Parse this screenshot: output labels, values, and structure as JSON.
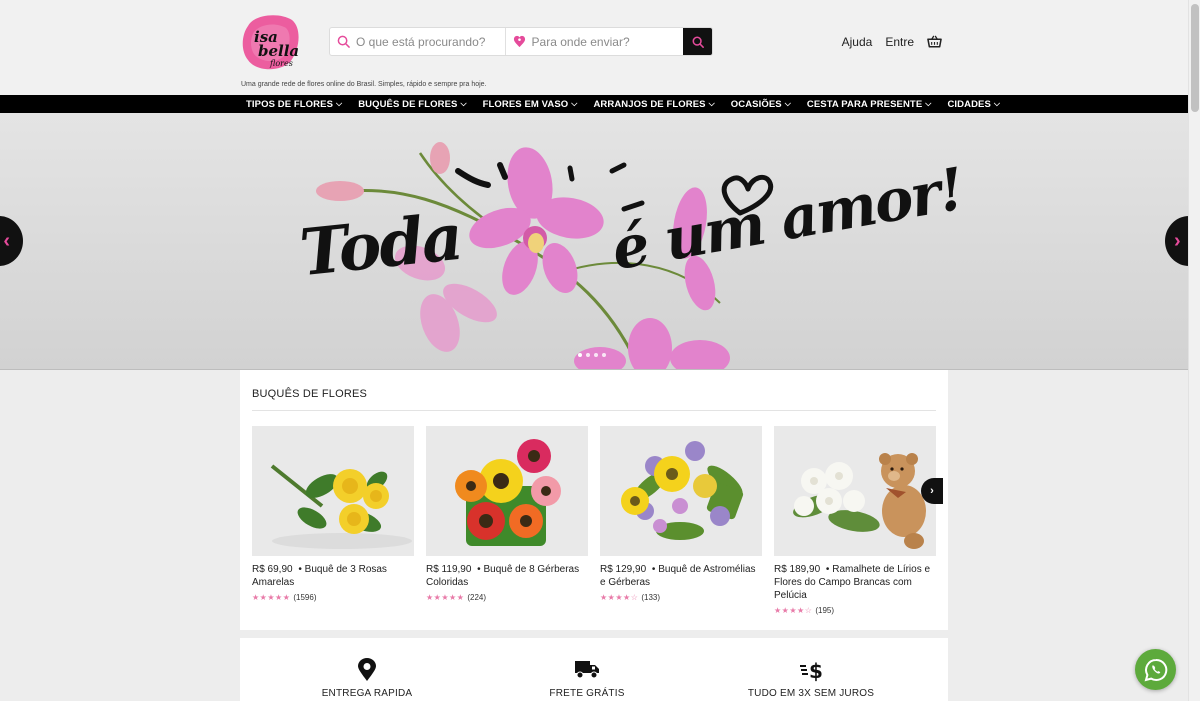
{
  "header": {
    "logo_text": "isa bella flores",
    "tagline": "Uma grande rede de flores online do Brasil. Simples, rápido e sempre pra hoje.",
    "search_placeholder": "O que está procurando?",
    "destination_placeholder": "Para onde enviar?",
    "help_label": "Ajuda",
    "login_label": "Entre"
  },
  "nav": {
    "items": [
      {
        "label": "TIPOS DE FLORES"
      },
      {
        "label": "BUQUÊS DE FLORES"
      },
      {
        "label": "FLORES EM VASO"
      },
      {
        "label": "ARRANJOS DE FLORES"
      },
      {
        "label": "OCASIÕES"
      },
      {
        "label": "CESTA PARA PRESENTE"
      },
      {
        "label": "CIDADES"
      }
    ]
  },
  "hero": {
    "text_left": "Toda",
    "text_right": "é um amor!",
    "slide_count": 4,
    "active_slide": 1
  },
  "products": {
    "section_title": "BUQUÊS DE FLORES",
    "items": [
      {
        "price": "R$ 69,90",
        "name": "Buquê de 3 Rosas Amarelas",
        "rating": 5,
        "reviews": "(1596)"
      },
      {
        "price": "R$ 119,90",
        "name": "Buquê de 8 Gérberas Coloridas",
        "rating": 5,
        "reviews": "(224)"
      },
      {
        "price": "R$ 129,90",
        "name": "Buquê de Astromélias e Gérberas",
        "rating": 4.5,
        "reviews": "(133)"
      },
      {
        "price": "R$ 189,90",
        "name": "Ramalhete de Lírios e Flores do Campo Brancas com Pelúcia",
        "rating": 4.5,
        "reviews": "(195)"
      }
    ]
  },
  "features": {
    "items": [
      {
        "label": "ENTREGA RAPIDA",
        "icon": "location-pin-icon"
      },
      {
        "label": "FRETE GRÁTIS",
        "icon": "truck-icon"
      },
      {
        "label": "TUDO EM 3X SEM JUROS",
        "icon": "dollar-icon"
      }
    ]
  },
  "colors": {
    "accent": "#e54b9b",
    "nav_bg": "#000000",
    "whatsapp": "#5daa3c"
  }
}
